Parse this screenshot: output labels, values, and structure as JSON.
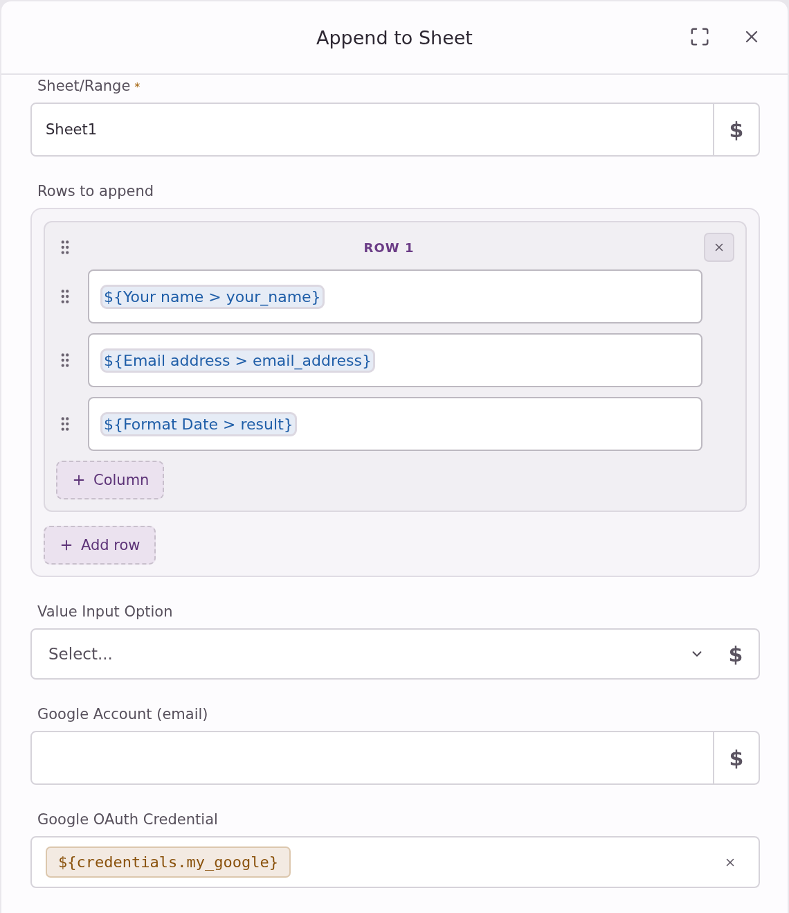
{
  "dialog": {
    "title": "Append to Sheet"
  },
  "fields": [
    {
      "kind": "text",
      "label": "Sheet/Range",
      "required_mark": "*",
      "value": "Sheet1",
      "dollar": "$"
    },
    {
      "kind": "rows",
      "label": "Rows to append",
      "rows": [
        {
          "title": "ROW 1",
          "columns": [
            "${Your name > your_name}",
            "${Email address > email_address}",
            "${Format Date > result}"
          ],
          "add_column": "Column"
        }
      ],
      "add_row": "Add row"
    },
    {
      "kind": "select",
      "label": "Value Input Option",
      "placeholder": "Select...",
      "dollar": "$"
    },
    {
      "kind": "text",
      "label": "Google Account (email)",
      "dollar": "$"
    },
    {
      "kind": "credential",
      "label": "Google OAuth Credential",
      "value": "${credentials.my_google}"
    }
  ]
}
